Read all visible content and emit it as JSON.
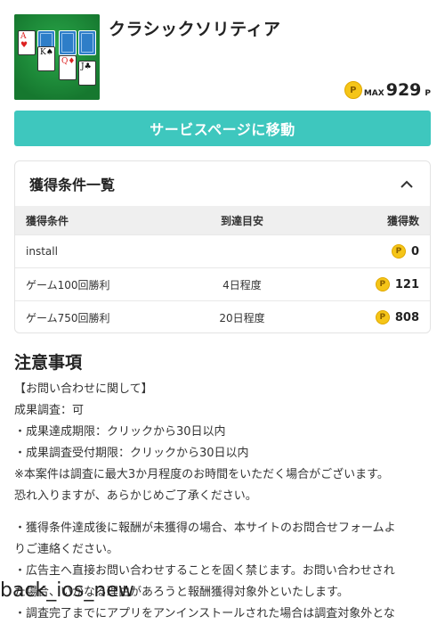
{
  "app": {
    "title": "クラシックソリティア",
    "reward_max_label": "MAX",
    "reward_max_value": "929",
    "reward_unit": "P",
    "coin_symbol": "P",
    "cards": {
      "a": "A",
      "k": "K",
      "q": "Q",
      "j": "J",
      "heart": "♥",
      "spade": "♠",
      "diamond": "♦",
      "club": "♣"
    }
  },
  "service_button": "サービスページに移動",
  "conditions": {
    "title": "獲得条件一覧",
    "headers": [
      "獲得条件",
      "到達目安",
      "獲得数"
    ],
    "rows": [
      {
        "condition": "install",
        "estimate": "",
        "points": "0"
      },
      {
        "condition": "ゲーム100回勝利",
        "estimate": "4日程度",
        "points": "121"
      },
      {
        "condition": "ゲーム750回勝利",
        "estimate": "20日程度",
        "points": "808"
      }
    ]
  },
  "notes": {
    "title": "注意事項",
    "lines": [
      "【お問い合わせに関して】",
      "成果調査：可",
      "・成果達成期限：クリックから30日以内",
      "・成果調査受付期限：クリックから30日以内",
      "※本案件は調査に最大3か月程度のお時間をいただく場合がございます。",
      "恐れ入りますが、あらかじめご了承ください。"
    ],
    "lines2": [
      "・獲得条件達成後に報酬が未獲得の場合、本サイトのお問合せフォームよ",
      "りご連絡ください。",
      "・広告主へ直接お問い合わせすることを固く禁じます。お問い合わせされ",
      "た場合、いかなる理由があろうと報酬獲得対象外といたします。",
      "・調査完了までにアプリをアンインストールされた場合は調査対象外とな"
    ]
  },
  "overlay_text": "back_ios_new",
  "colors": {
    "accent": "#3ec7be",
    "coin": "#f5c518",
    "header_bg": "#efefef"
  }
}
